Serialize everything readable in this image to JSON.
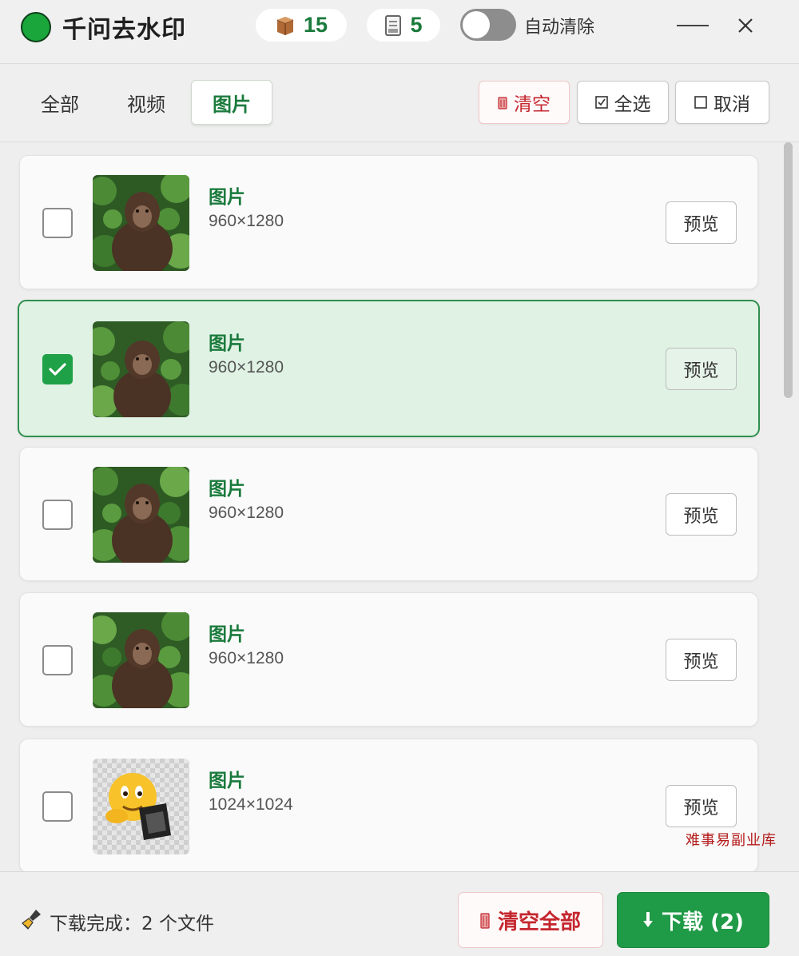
{
  "app": {
    "title": "千问去水印",
    "accent_color": "#1a7a3c",
    "status_dot_color": "#1aa63a"
  },
  "header": {
    "video_count": "15",
    "video_icon": "video-box-icon",
    "image_count": "5",
    "image_icon": "image-doc-icon",
    "auto_clear_label": "自动清除",
    "auto_clear_on": false,
    "minimize_icon": "minimize-icon",
    "close_icon": "close-icon"
  },
  "tabs": {
    "all": "全部",
    "video": "视频",
    "image": "图片",
    "active": "image"
  },
  "toolbar": {
    "clear_label": "清空",
    "select_all_label": "全选",
    "cancel_label": "取消"
  },
  "items": [
    {
      "type": "图片",
      "dimensions": "960×1280",
      "checked": false,
      "thumb": "monkey",
      "preview_label": "预览"
    },
    {
      "type": "图片",
      "dimensions": "960×1280",
      "checked": true,
      "thumb": "monkey",
      "preview_label": "预览"
    },
    {
      "type": "图片",
      "dimensions": "960×1280",
      "checked": false,
      "thumb": "monkey",
      "preview_label": "预览"
    },
    {
      "type": "图片",
      "dimensions": "960×1280",
      "checked": false,
      "thumb": "monkey",
      "preview_label": "预览"
    },
    {
      "type": "图片",
      "dimensions": "1024×1024",
      "checked": false,
      "thumb": "emoji",
      "preview_label": "预览"
    }
  ],
  "watermark": "难事易副业库",
  "footer": {
    "status_text": "下载完成：2 个文件",
    "clear_all_label": "清空全部",
    "download_label": "下载 (2)"
  }
}
